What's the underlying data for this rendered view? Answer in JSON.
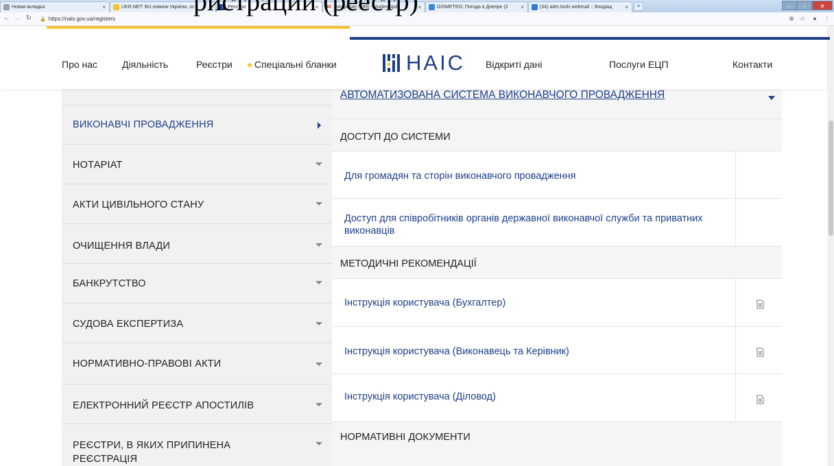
{
  "page_caption": "ристрации (реестр)",
  "browser": {
    "tabs": [
      {
        "label": "Новая вкладка",
        "close": "×",
        "fav_color": "#9aa0a6"
      },
      {
        "label": "UKR.NET: Всі новини України, ос",
        "close": "×",
        "fav_color": "#f4c430"
      },
      {
        "label": "Реєстри",
        "close": "×",
        "fav_color": "#1d3f8a"
      },
      {
        "label": "Входящие (189) - studentbpd2",
        "close": "×",
        "fav_color": "#d93025"
      },
      {
        "label": "GISMETEO: Погода в Днепре (2",
        "close": "×",
        "fav_color": "#3a88d8"
      },
      {
        "label": "(34) adm.tools webmail :: Входящ",
        "close": "×",
        "fav_color": "#2d7dd2"
      }
    ],
    "new_tab": "+",
    "url": "https://nais.gov.ua/registers",
    "win_buttons": [
      "–",
      "▫",
      "✕"
    ]
  },
  "header": {
    "nav_left": [
      "Про нас",
      "Діяльність",
      "Реєстри",
      "Спеціальні бланки"
    ],
    "logo_text": "НАІС",
    "nav_right": [
      "Відкриті дані",
      "Послуги ЕЦП",
      "Контакти"
    ]
  },
  "sidebar": {
    "items": [
      {
        "label": "ВИКОНАВЧІ ПРОВАДЖЕННЯ",
        "active": true
      },
      {
        "label": "НОТАРІАТ"
      },
      {
        "label": "АКТИ ЦИВІЛЬНОГО СТАНУ"
      },
      {
        "label": "ОЧИЩЕННЯ ВЛАДИ"
      },
      {
        "label": "БАНКРУТСТВО"
      },
      {
        "label": "СУДОВА ЕКСПЕРТИЗА"
      },
      {
        "label": "НОРМАТИВНО-ПРАВОВІ АКТИ"
      },
      {
        "label": "ЕЛЕКТРОННИЙ РЕЄСТР АПОСТИЛІВ"
      },
      {
        "label": "РЕЄСТРИ, В ЯКИХ ПРИПИНЕНА РЕЄСТРАЦІЯ"
      }
    ]
  },
  "panel": {
    "title": "АВТОМАТИЗОВАНА СИСТЕМА ВИКОНАВЧОГО ПРОВАДЖЕННЯ",
    "section_access": "ДОСТУП ДО СИСТЕМИ",
    "access_links": [
      "Для громадян та сторін виконавчого провадження",
      "Доступ для співробітників органів державної виконавчої служби та приватних виконавців"
    ],
    "section_methods": "МЕТОДИЧНІ РЕКОМЕНДАЦІЇ",
    "method_links": [
      "Інструкція користувача (Бухгалтер)",
      "Інструкція користувача (Виконавець та Керівник)",
      "Інструкція користувача (Діловод)"
    ],
    "section_norms": "НОРМАТИВНІ ДОКУМЕНТИ"
  },
  "colors": {
    "brand_blue": "#1d3f8a",
    "accent_yellow": "#f4c430",
    "sidebar_bg": "#f1f1f1"
  }
}
